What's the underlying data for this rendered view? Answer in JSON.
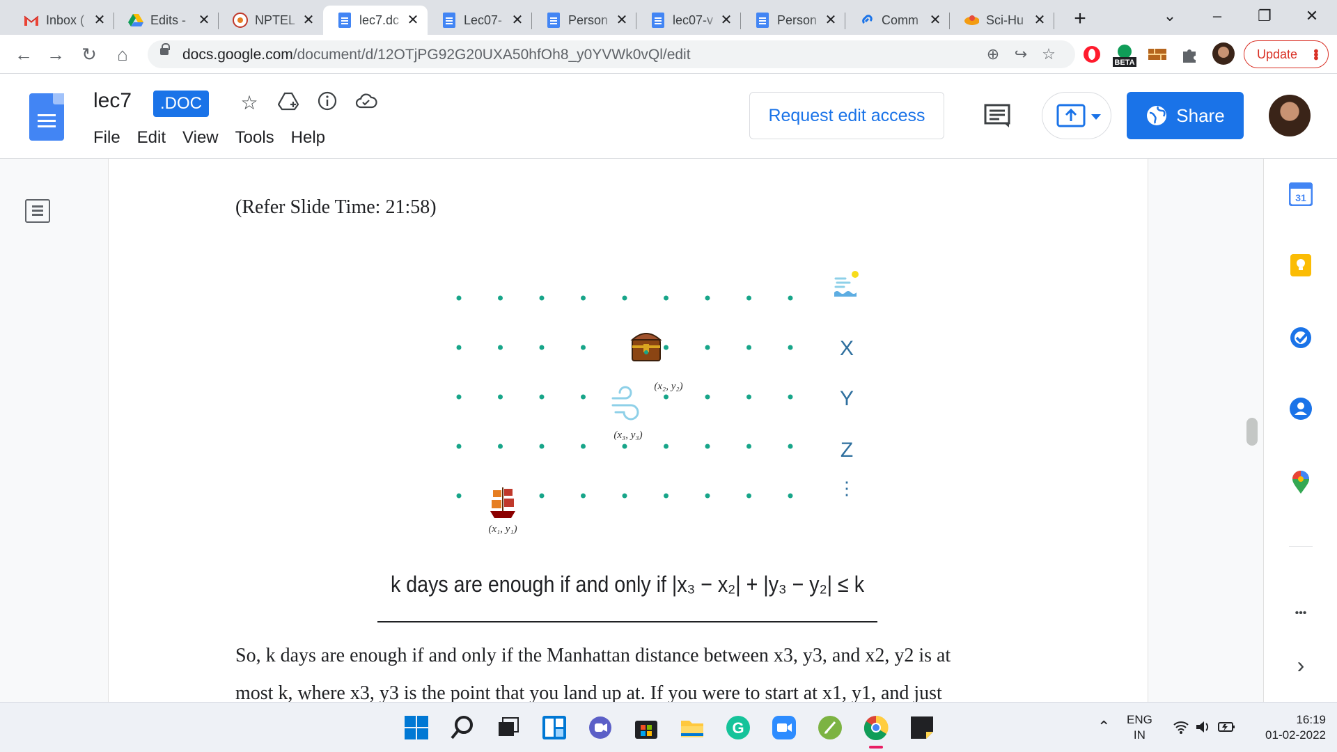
{
  "browser": {
    "tabs": [
      {
        "title": "Inbox (",
        "icon": "gmail-icon"
      },
      {
        "title": "Edits -",
        "icon": "drive-icon"
      },
      {
        "title": "NPTEL",
        "icon": "nptel-icon"
      },
      {
        "title": "lec7.dc",
        "icon": "docs-icon",
        "active": true
      },
      {
        "title": "Lec07-",
        "icon": "docs-icon"
      },
      {
        "title": "Person",
        "icon": "docs-icon"
      },
      {
        "title": "lec07-v",
        "icon": "docs-icon"
      },
      {
        "title": "Person",
        "icon": "docs-icon"
      },
      {
        "title": "Comm",
        "icon": "link-icon"
      },
      {
        "title": "Sci-Hu",
        "icon": "scihub-icon"
      }
    ],
    "new_tab": "+",
    "url_host": "docs.google.com",
    "url_path": "/document/d/12OTjPG92G20UXA50hfOh8_y0YVWk0vQl/edit",
    "beta_badge": "BETA",
    "update_label": "Update"
  },
  "docs": {
    "title": "lec7",
    "badge": ".DOC",
    "menu": [
      "File",
      "Edit",
      "View",
      "Tools",
      "Help"
    ],
    "request_edit": "Request edit access",
    "share": "Share"
  },
  "document": {
    "refer_line": "(Refer Slide Time: 21:58)",
    "paragraph_line1": "So, k days are enough if and only if the Manhattan distance between x3, y3, and x2, y2 is at",
    "paragraph_line2": "most k, where x3, y3 is the point that you land up at. If you were to start at x1, y1, and just"
  },
  "slide": {
    "labels": {
      "p2": "(x₂, y₂)",
      "p3": "(x₃, y₃)",
      "p1": "(x₁, y₁)"
    },
    "legend": [
      "X",
      "Y",
      "Z",
      "⋮"
    ],
    "formula": "k days are enough if and only if |x₃ − x₂| + |y₃ − y₂| ≤ k",
    "dot_color": "#17a589"
  },
  "sidepanel": {
    "calendar_day": "31",
    "more": "•••",
    "expand": "›"
  },
  "taskbar": {
    "lang_line1": "ENG",
    "lang_line2": "IN",
    "time": "16:19",
    "date": "01-02-2022"
  }
}
